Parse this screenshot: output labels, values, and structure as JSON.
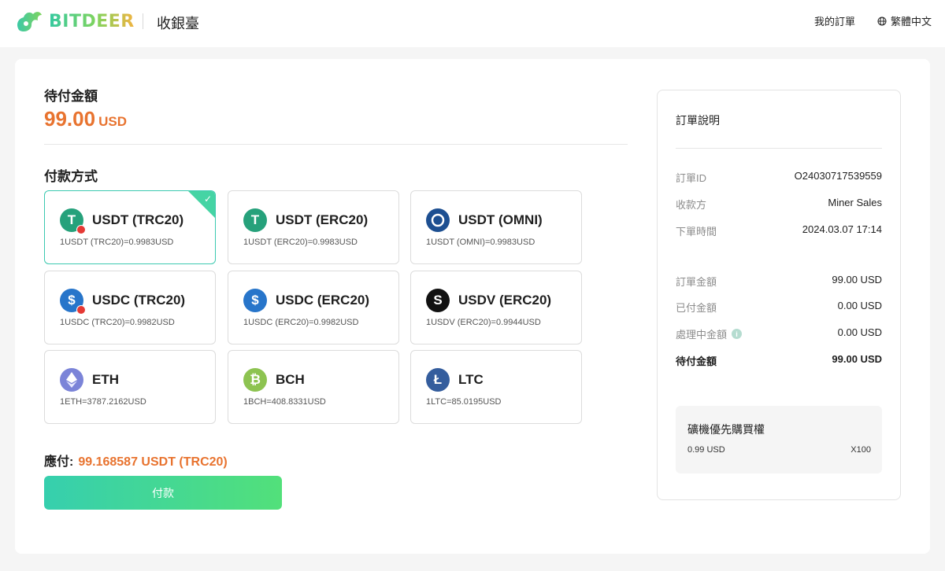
{
  "header": {
    "brand": "BITDEER",
    "title": "收銀臺",
    "my_orders": "我的訂單",
    "language": "繁體中文"
  },
  "payment": {
    "due_label": "待付金額",
    "due_amount": "99.00",
    "due_currency": "USD",
    "method_label": "付款方式",
    "methods": [
      {
        "name": "USDT (TRC20)",
        "rate": "1USDT (TRC20)=0.9983USD",
        "icon": "tether-trc20-icon",
        "selected": true
      },
      {
        "name": "USDT (ERC20)",
        "rate": "1USDT (ERC20)=0.9983USD",
        "icon": "tether-icon"
      },
      {
        "name": "USDT (OMNI)",
        "rate": "1USDT (OMNI)=0.9983USD",
        "icon": "omni-icon"
      },
      {
        "name": "USDC (TRC20)",
        "rate": "1USDC (TRC20)=0.9982USD",
        "icon": "usdc-trc20-icon"
      },
      {
        "name": "USDC (ERC20)",
        "rate": "1USDC (ERC20)=0.9982USD",
        "icon": "usdc-icon"
      },
      {
        "name": "USDV (ERC20)",
        "rate": "1USDV (ERC20)=0.9944USD",
        "icon": "usdv-icon"
      },
      {
        "name": "ETH",
        "rate": "1ETH=3787.2162USD",
        "icon": "ethereum-icon"
      },
      {
        "name": "BCH",
        "rate": "1BCH=408.8331USD",
        "icon": "bitcoin-cash-icon"
      },
      {
        "name": "LTC",
        "rate": "1LTC=85.0195USD",
        "icon": "litecoin-icon"
      }
    ],
    "payable_label": "應付:",
    "payable_value": "99.168587 USDT (TRC20)",
    "pay_button": "付款"
  },
  "order": {
    "title": "訂單說明",
    "id_label": "訂單ID",
    "id_value": "O24030717539559",
    "payee_label": "收款方",
    "payee_value": "Miner Sales",
    "time_label": "下單時間",
    "time_value": "2024.03.07 17:14",
    "amount_label": "訂單金額",
    "amount_value": "99.00 USD",
    "paid_label": "已付金額",
    "paid_value": "0.00 USD",
    "processing_label": "處理中金額",
    "processing_value": "0.00 USD",
    "pending_label": "待付金額",
    "pending_value": "99.00 USD",
    "promo": {
      "title": "礦機優先購買權",
      "price": "0.99 USD",
      "qty": "X100"
    }
  },
  "colors": {
    "accent_orange": "#e8732f",
    "accent_green": "#36cfae",
    "selected_border": "#3cc9b0"
  }
}
